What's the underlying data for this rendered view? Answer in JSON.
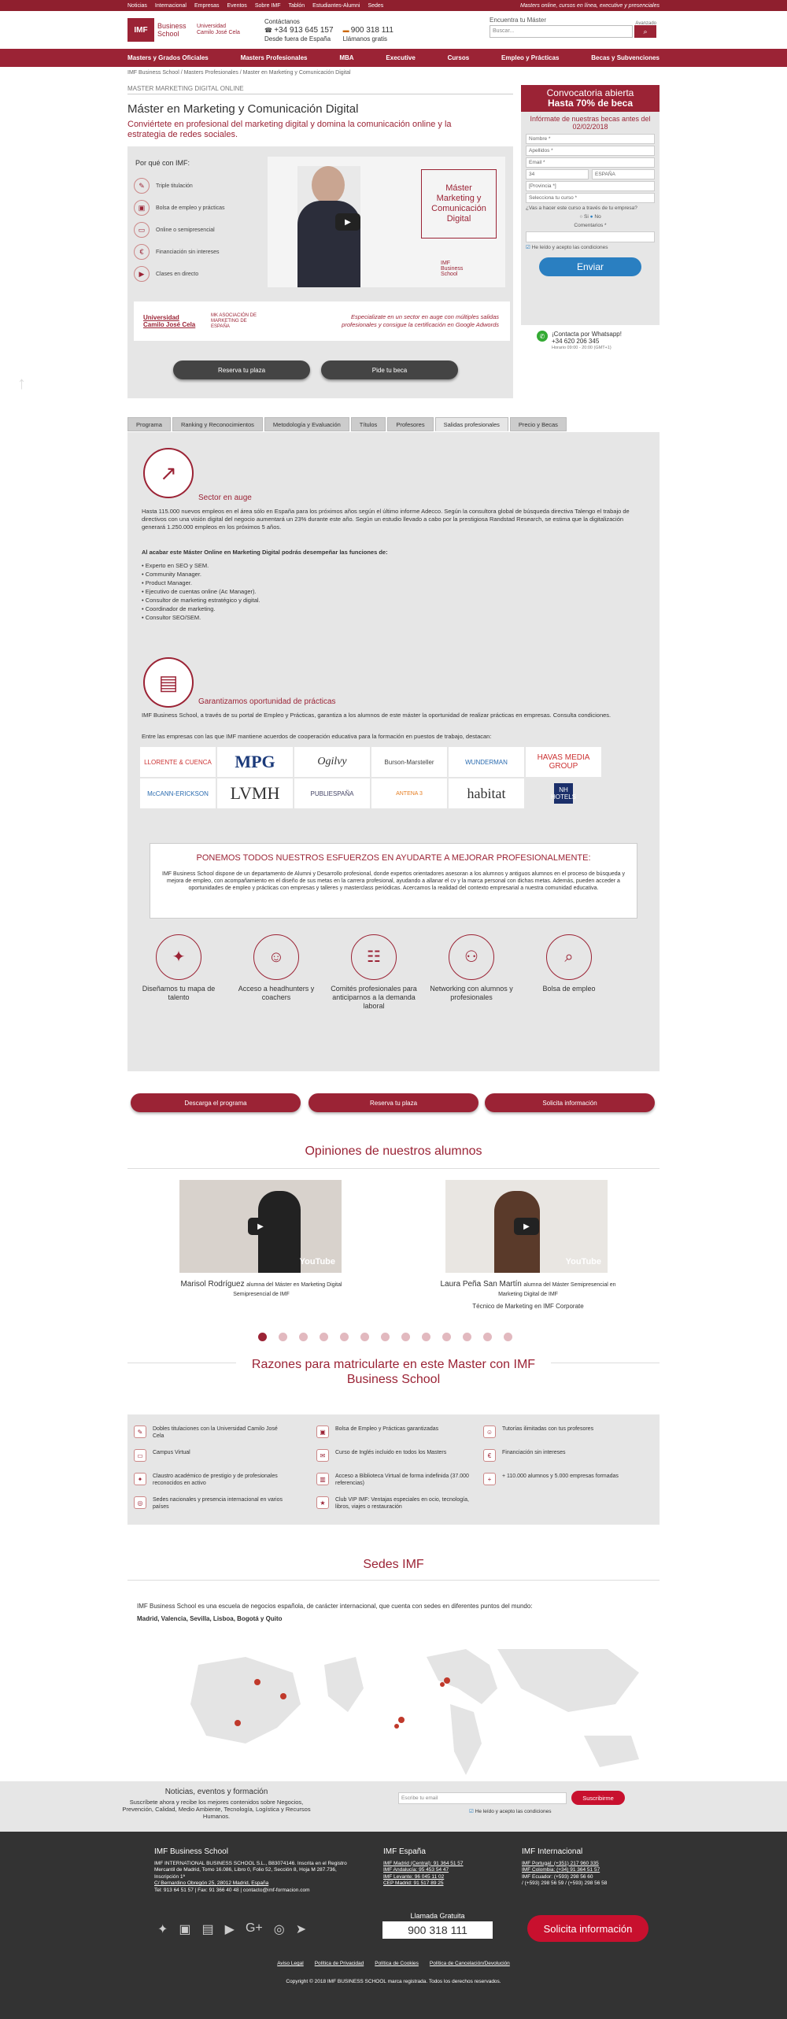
{
  "topbar": {
    "links": [
      "Noticias",
      "Internacional",
      "Empresas",
      "Eventos",
      "Sobre IMF",
      "Tablón",
      "Estudiantes-Alumni",
      "Sedes"
    ],
    "tagline": "Masters online, cursos en línea, executive y presenciales"
  },
  "header": {
    "logo": "IMF",
    "school": "Business School",
    "ucjc": "Universidad Camilo José Cela",
    "contact_label": "Contáctanos",
    "phone1": "+34 913 645 157",
    "phone1_sub": "Desde fuera de España",
    "phone2": "900 318 111",
    "phone2_sub": "Llámanos gratis",
    "search_label": "Encuentra tu Máster",
    "search_placeholder": "Buscar...",
    "advanced": "Avanzado"
  },
  "nav": [
    "Masters y Grados Oficiales",
    "Masters Profesionales",
    "MBA",
    "Executive",
    "Cursos",
    "Empleo y Prácticas",
    "Becas y Subvenciones"
  ],
  "breadcrumb": "IMF Business School / Masters Profesionales / Master en Marketing y Comunicación Digital",
  "subtitle": "MASTER MARKETING DIGITAL ONLINE",
  "title": "Máster en Marketing y Comunicación Digital",
  "lead": "Conviértete en profesional del marketing digital y domina la comunicación online y la estrategia de redes sociales.",
  "hero": {
    "why": "Por qué con IMF:",
    "benefits": [
      "Triple titulación",
      "Bolsa de empleo y prácticas",
      "Online o semipresencial",
      "Financiación sin intereses",
      "Clases en directo"
    ],
    "video_title": "Máster Marketing y Comunicación Digital",
    "video_logo": "IMF Business School",
    "partner_u": "Universidad Camilo José Cela",
    "partner_mk": "MK ASOCIACIÓN DE MARKETING DE ESPAÑA",
    "partner_text": "Especializate en un sector en auge con múltiples salidas profesionales y consigue la certificación en Google Adwords",
    "btn1": "Reserva tu plaza",
    "btn2": "Pide tu beca"
  },
  "form": {
    "head1": "Convocatoria abierta",
    "head2": "Hasta 70% de beca",
    "info": "Infórmate de nuestras becas antes del 02/02/2018",
    "fields": [
      "Nombre *",
      "Apellidos *",
      "Email *"
    ],
    "prefix": "34",
    "country": "ESPAÑA",
    "province": "[Provincia *]",
    "course": "Selecciona tu curso *",
    "question": "¿Vas a hacer este curso a través de tu empresa?",
    "si": "Si",
    "no": "No",
    "comments": "Comentarios *",
    "accept": "He leído y acepto las condiciones",
    "submit": "Enviar"
  },
  "whatsapp": {
    "label": "¡Contacta por Whatsapp!",
    "number": "+34 620 206 345",
    "hours": "Horario 09:00 - 20:00 (GMT+1)"
  },
  "tabs": [
    "Programa",
    "Ranking y Reconocimientos",
    "Metodología y Evaluación",
    "Títulos",
    "Profesores",
    "Salidas profesionales",
    "Precio y Becas"
  ],
  "sec1": {
    "title": "Sector en auge",
    "p1": "Hasta 115.000 nuevos empleos en el área sólo en España para los próximos años según el último informe Adecco. Según la consultora global de búsqueda directiva Talengo el trabajo de directivos con una visión digital del negocio aumentará un 23% durante este año. Según un estudio llevado a cabo por la prestigiosa Randstad Research, se estima que la digitalización generará 1.250.000 empleos en los próximos 5 años.",
    "p2": "Al acabar este Máster Online en Marketing Digital podrás desempeñar las funciones de:",
    "list": [
      "Experto en SEO y SEM.",
      "Community Manager.",
      "Product Manager.",
      "Ejecutivo de cuentas online (Ac Manager).",
      "Consultor de marketing estratégico y digital.",
      "Coordinador de marketing.",
      "Consultor SEO/SEM."
    ]
  },
  "sec2": {
    "title": "Garantizamos oportunidad de prácticas",
    "p1": "IMF Business School, a través de su portal de Empleo y Prácticas, garantiza a los alumnos de este máster la oportunidad de realizar prácticas en empresas. Consulta condiciones.",
    "p2": "Entre las empresas con las que IMF mantiene acuerdos de cooperación educativa para la formación en puestos de trabajo, destacan:",
    "logos": [
      "LLORENTE & CUENCA",
      "MPG",
      "Ogilvy",
      "Burson-Marsteller",
      "WUNDERMAN",
      "HAVAS MEDIA GROUP",
      "McCANN-ERICKSON",
      "LVMH",
      "PUBLIESPAÑA",
      "ANTENA 3",
      "habitat",
      "NH HOTELS"
    ]
  },
  "box": {
    "title": "PONEMOS TODOS NUESTROS ESFUERZOS EN AYUDARTE A MEJORAR PROFESIONALMENTE:",
    "body": "IMF Business School dispone de un departamento de Alumni y Desarrollo profesional, donde expertos orientadores asesoran a los alumnos y antiguos alumnos en el proceso de búsqueda y mejora de empleo, con acompañamiento en el diseño de sus metas en la carrera profesional, ayudando a allanar el cv y la marca personal con dichas metas. Además, pueden acceder a oportunidades de empleo y prácticas con empresas y talleres y masterclass periódicas. Acercamos la realidad del contexto empresarial a nuestra comunidad educativa."
  },
  "services": [
    "Diseñamos tu mapa de talento",
    "Acceso a headhunters y coachers",
    "Comités profesionales para anticiparnos a la demanda laboral",
    "Networking con alumnos y profesionales",
    "Bolsa de empleo"
  ],
  "cta": [
    "Descarga el programa",
    "Reserva tu plaza",
    "Solicita información"
  ],
  "opinions": {
    "title": "Opiniones de nuestros alumnos",
    "t1_name": "Marisol Rodríguez",
    "t1_desc": "alumna del Máster en Marketing Digital Semipresencial de IMF",
    "t2_name": "Laura Peña San Martín",
    "t2_desc": "alumna del Máster Semipresencial en Marketing Digital de IMF",
    "t2_role": "Técnico de Marketing en IMF Corporate",
    "yt": "YouTube"
  },
  "reasons": {
    "title": "Razones para matricularte en este Master con IMF Business School",
    "items": [
      "Dobles titulaciones con la Universidad Camilo José Cela",
      "Bolsa de Empleo y Prácticas garantizadas",
      "Tutorías ilimitadas con tus profesores",
      "Campus Virtual",
      "Curso de Inglés incluido en todos los Masters",
      "Financiación sin intereses",
      "Claustro académico de prestigio y de profesionales reconocidos en activo",
      "Acceso a Biblioteca Virtual de forma indefinida (37.000 referencias)",
      "+ 110.000 alumnos y 5.000 empresas formadas",
      "Sedes nacionales y presencia internacional en varios países",
      "Club VIP IMF: Ventajas especiales en ocio, tecnología, libros, viajes o restauración"
    ]
  },
  "sedes": {
    "title": "Sedes IMF",
    "p1": "IMF Business School es una escuela de negocios española, de carácter internacional, que cuenta con sedes en diferentes puntos del mundo:",
    "p2": "Madrid, Valencia, Sevilla, Lisboa, Bogotá y Quito"
  },
  "news": {
    "title": "Noticias, eventos y formación",
    "body": "Suscríbete ahora y recibe los mejores contenidos sobre Negocios, Prevención, Calidad, Medio Ambiente, Tecnología, Logística y Recursos Humanos.",
    "placeholder": "Escribe tu email",
    "btn": "Suscribirme",
    "accept": "He leído y acepto las condiciones"
  },
  "footer": {
    "c1_title": "IMF Business School",
    "c1_body": "IMF INTERNATIONAL BUSINESS SCHOOL S.L., B83074146. Inscrita en el Registro Mercantil de Madrid, Tomo 16.086, Libro 0, Folio 52, Sección 8, Hoja M 287.736, Inscripción 1ª",
    "c1_addr": "C/ Bernardino Obregón 25, 28012 Madrid, España",
    "c1_tel": "Tel: 913 64 51 57 | Fax: 91 366 40 48 | contacto@imf-formacion.com",
    "c2_title": "IMF España",
    "c2_lines": [
      "IMF Madrid (Central): 91 364 51 57",
      "IMF Andalucía: 95 453 54 47",
      "IMF Levante: 96 045 11 02",
      "CEP Madrid: 91 517 89 25"
    ],
    "c3_title": "IMF Internacional",
    "c3_lines": [
      "IMF Portugal: (+351) 217 960 335",
      "IMF Colombia: (+34) 91 364 51 57",
      "IMF Ecuador: (+593) 298 56 60",
      "/ (+593) 298 56 59 / (+593) 298 56 58"
    ],
    "call": "Llamada Gratuita",
    "phone": "900 318 111",
    "solicita": "Solicita información",
    "legal": [
      "Aviso Legal",
      "Política de Privacidad",
      "Política de Cookies",
      "Política de Cancelación/Devolución"
    ],
    "copy": "Copyright © 2018 IMF BUSINESS SCHOOL marca registrada. Todos los derechos reservados."
  }
}
